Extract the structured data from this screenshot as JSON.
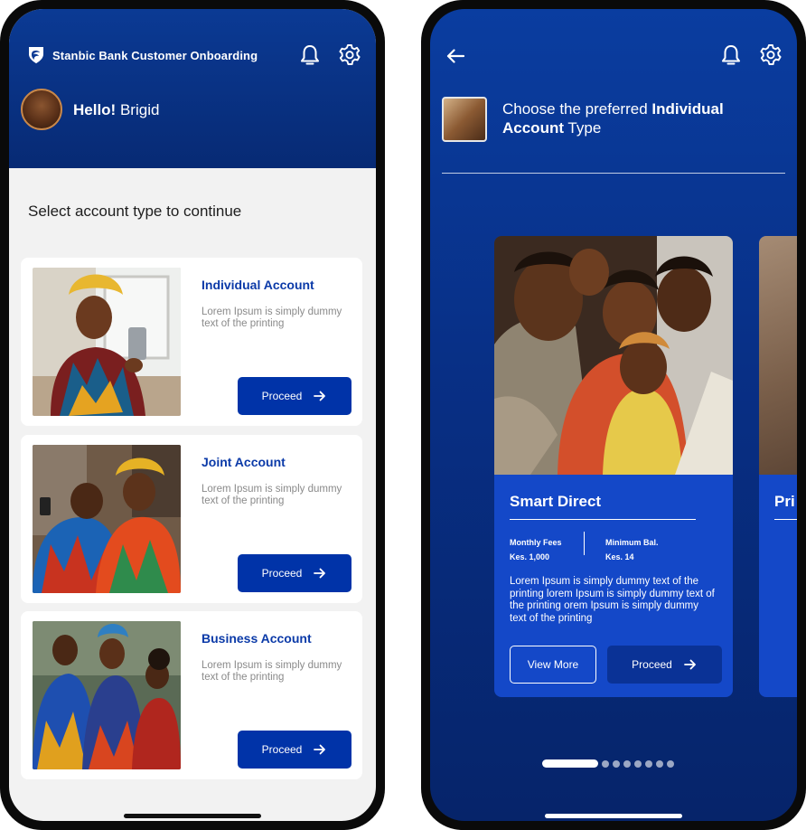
{
  "colors": {
    "brand_blue": "#0033a8",
    "header_blue": "#072a74",
    "card_blue": "#1448c8",
    "link_blue": "#0b3aa8",
    "page_bg": "#f2f2f2"
  },
  "screen1": {
    "header": {
      "app_title": "Stanbic Bank Customer Onboarding",
      "logo_icon": "stanbic-shield-icon",
      "notification_icon": "bell-icon",
      "settings_icon": "gear-icon",
      "greeting_prefix": "Hello!",
      "user_name": "Brigid"
    },
    "section_title": "Select account type to continue",
    "accounts": [
      {
        "title": "Individual Account",
        "description": "Lorem Ipsum is simply dummy text of the printing",
        "button_label": "Proceed"
      },
      {
        "title": "Joint Account",
        "description": "Lorem Ipsum is simply dummy text of the printing",
        "button_label": "Proceed"
      },
      {
        "title": "Business Account",
        "description": "Lorem Ipsum is simply dummy text of the printing",
        "button_label": "Proceed"
      }
    ]
  },
  "screen2": {
    "header": {
      "back_icon": "arrow-left-icon",
      "notification_icon": "bell-icon",
      "settings_icon": "gear-icon"
    },
    "prompt_prefix": "Choose the preferred ",
    "prompt_bold": "Individual Account",
    "prompt_suffix": " Type",
    "product": {
      "title": "Smart Direct",
      "fees_label": "Monthly Fees",
      "fees_value": "Kes. 1,000",
      "min_label": "Minimum Bal.",
      "min_value": "Kes. 14",
      "description": "Lorem Ipsum is simply dummy text of the printing lorem Ipsum is simply dummy text of the printing orem Ipsum is simply dummy text of the printing",
      "view_more_label": "View More",
      "proceed_label": "Proceed"
    },
    "next_product_title": "Pri",
    "pagination": {
      "total": 8,
      "active": 1
    }
  }
}
